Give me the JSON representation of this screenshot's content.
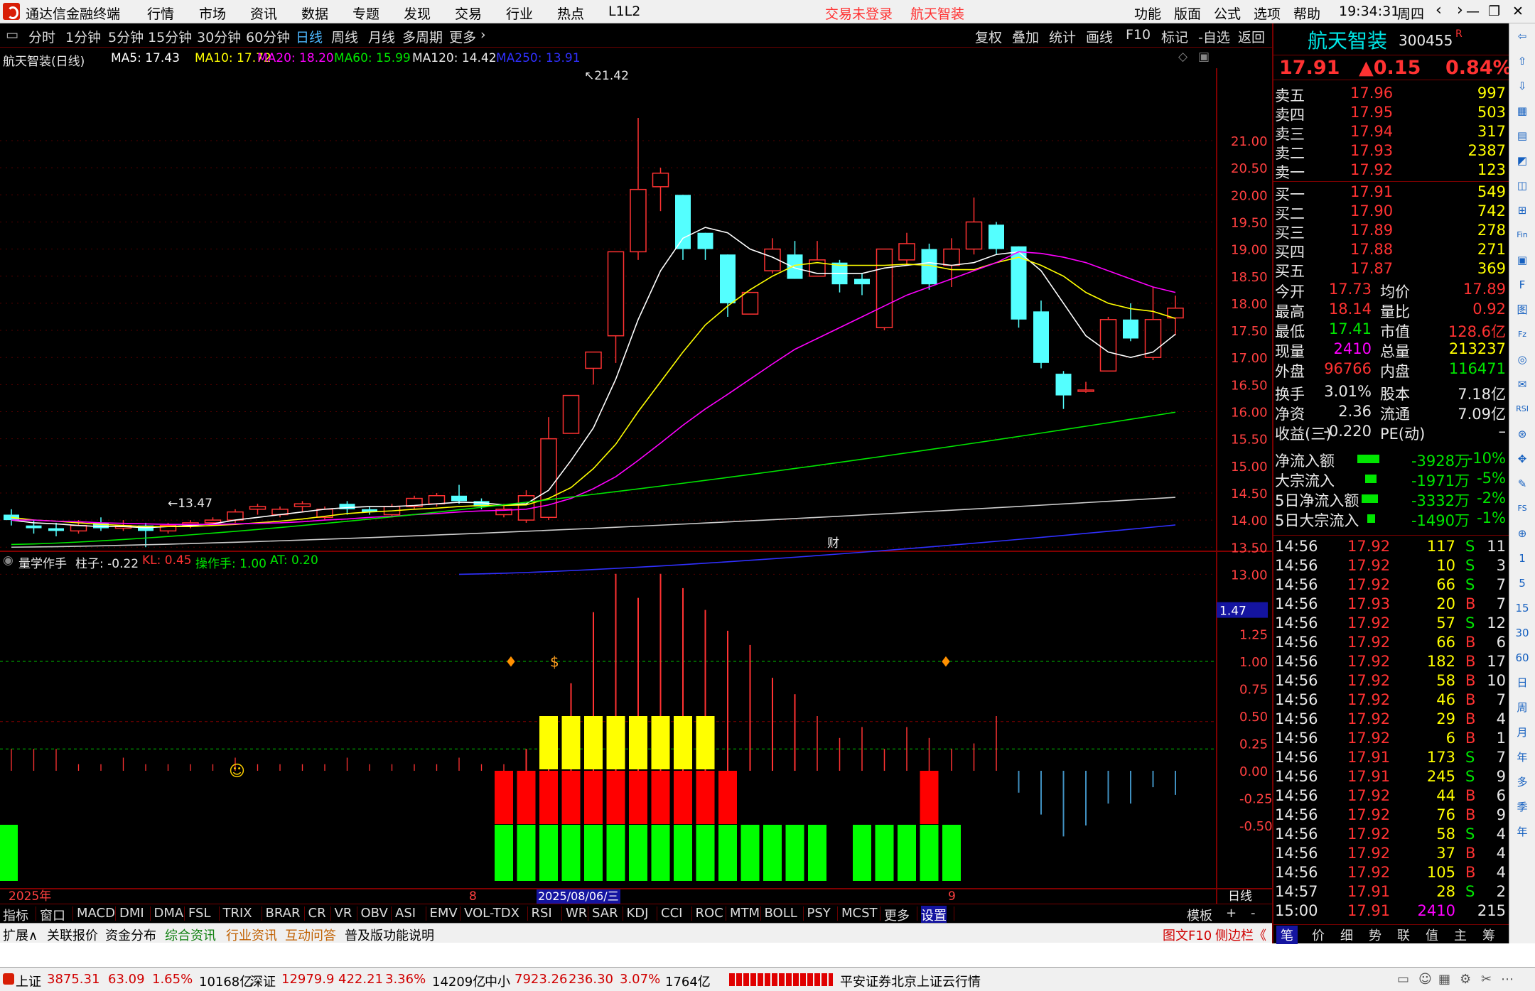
{
  "app": {
    "title": "通达信金融终端",
    "menus": [
      "行情",
      "市场",
      "资讯",
      "数据",
      "专题",
      "发现",
      "交易",
      "行业",
      "热点",
      "L1L2"
    ],
    "login": "交易未登录",
    "stock_link": "航天智装",
    "right_menus": [
      "功能",
      "版面",
      "公式",
      "选项",
      "帮助"
    ],
    "time": "19:34:31",
    "weekday": "周四"
  },
  "toolbar": {
    "periods": [
      "分时",
      "1分钟",
      "5分钟",
      "15分钟",
      "30分钟",
      "60分钟",
      "日线",
      "周线",
      "月线",
      "多周期",
      "更多"
    ],
    "active": "日线",
    "tools": [
      "复权",
      "叠加",
      "统计",
      "画线",
      "F10",
      "标记",
      "-自选",
      "返回"
    ]
  },
  "main_chart": {
    "name": "航天智装(日线)",
    "ma": [
      {
        "label": "MA5: 17.43",
        "color": "#ffffff"
      },
      {
        "label": "MA10: 17.72",
        "color": "#ffff00"
      },
      {
        "label": "MA20: 18.20",
        "color": "#ff00ff"
      },
      {
        "label": "MA60: 15.99",
        "color": "#00e600"
      },
      {
        "label": "MA120: 14.42",
        "color": "#e8e8e8"
      },
      {
        "label": "MA250: 13.91",
        "color": "#3030ff"
      }
    ],
    "high_label": "21.42",
    "low_label": "13.47",
    "marker": "财",
    "axis": [
      "21.00",
      "20.50",
      "20.00",
      "19.50",
      "19.00",
      "18.50",
      "18.00",
      "17.50",
      "17.00",
      "16.50",
      "16.00",
      "15.50",
      "15.00",
      "14.50",
      "14.00",
      "13.50",
      "13.00"
    ]
  },
  "chart_data": {
    "type": "candlestick",
    "candles": [
      [
        14.1,
        14.0,
        14.2,
        13.9
      ],
      [
        13.9,
        13.85,
        14.0,
        13.75
      ],
      [
        13.85,
        13.8,
        13.95,
        13.7
      ],
      [
        13.8,
        13.9,
        14.0,
        13.75
      ],
      [
        13.95,
        13.85,
        14.05,
        13.8
      ],
      [
        13.85,
        13.9,
        14.0,
        13.8
      ],
      [
        13.9,
        13.8,
        13.95,
        13.5
      ],
      [
        13.8,
        13.9,
        13.95,
        13.75
      ],
      [
        13.9,
        13.95,
        14.0,
        13.85
      ],
      [
        13.95,
        14.0,
        14.05,
        13.9
      ],
      [
        14.0,
        14.15,
        14.2,
        13.95
      ],
      [
        14.2,
        14.25,
        14.3,
        14.1
      ],
      [
        14.1,
        14.2,
        14.25,
        14.05
      ],
      [
        14.25,
        14.3,
        14.35,
        14.15
      ],
      [
        14.05,
        14.2,
        14.25,
        14.0
      ],
      [
        14.3,
        14.2,
        14.35,
        14.1
      ],
      [
        14.2,
        14.15,
        14.25,
        14.1
      ],
      [
        14.1,
        14.25,
        14.3,
        14.05
      ],
      [
        14.25,
        14.4,
        14.45,
        14.2
      ],
      [
        14.3,
        14.45,
        14.5,
        14.25
      ],
      [
        14.45,
        14.35,
        14.65,
        14.3
      ],
      [
        14.35,
        14.25,
        14.4,
        14.2
      ],
      [
        14.1,
        14.2,
        14.3,
        14.05
      ],
      [
        14.0,
        14.45,
        14.55,
        13.95
      ],
      [
        14.05,
        15.5,
        15.9,
        14.0
      ],
      [
        15.6,
        16.3,
        16.3,
        15.6
      ],
      [
        16.8,
        17.1,
        17.1,
        16.5
      ],
      [
        17.4,
        18.95,
        18.95,
        16.9
      ],
      [
        18.95,
        20.1,
        21.42,
        18.8
      ],
      [
        20.15,
        20.4,
        20.5,
        19.7
      ],
      [
        20.0,
        19.0,
        20.0,
        18.8
      ],
      [
        19.3,
        19.0,
        19.3,
        18.8
      ],
      [
        18.9,
        18.0,
        18.9,
        17.75
      ],
      [
        17.8,
        18.2,
        18.2,
        17.8
      ],
      [
        18.6,
        19.0,
        19.2,
        18.55
      ],
      [
        18.9,
        18.45,
        19.15,
        18.45
      ],
      [
        18.5,
        18.8,
        19.15,
        18.5
      ],
      [
        18.75,
        18.35,
        18.8,
        18.2
      ],
      [
        18.45,
        18.35,
        18.55,
        18.15
      ],
      [
        17.55,
        19.0,
        19.0,
        17.5
      ],
      [
        18.8,
        19.1,
        19.3,
        18.7
      ],
      [
        19.0,
        18.35,
        19.1,
        18.25
      ],
      [
        18.7,
        19.0,
        19.2,
        18.3
      ],
      [
        19.0,
        19.5,
        19.95,
        18.9
      ],
      [
        19.45,
        19.0,
        19.5,
        18.9
      ],
      [
        19.05,
        17.7,
        19.05,
        17.55
      ],
      [
        17.85,
        16.9,
        18.05,
        16.8
      ],
      [
        16.7,
        16.3,
        16.75,
        16.05
      ],
      [
        16.4,
        16.4,
        16.55,
        16.35
      ],
      [
        16.75,
        17.7,
        17.75,
        16.75
      ],
      [
        17.7,
        17.35,
        18.0,
        17.3
      ],
      [
        17.0,
        17.7,
        18.3,
        16.95
      ],
      [
        17.73,
        17.91,
        18.14,
        17.41
      ]
    ],
    "ma5": [
      14.0,
      13.95,
      13.93,
      13.9,
      13.88,
      13.88,
      13.86,
      13.88,
      13.9,
      13.93,
      14.0,
      14.05,
      14.1,
      14.15,
      14.2,
      14.23,
      14.25,
      14.25,
      14.27,
      14.3,
      14.33,
      14.32,
      14.28,
      14.3,
      14.55,
      15.1,
      15.7,
      16.6,
      17.7,
      18.6,
      19.2,
      19.4,
      19.3,
      19.0,
      18.85,
      18.65,
      18.55,
      18.55,
      18.55,
      18.65,
      18.7,
      18.75,
      18.7,
      18.75,
      18.9,
      18.95,
      18.6,
      18.0,
      17.4,
      17.1,
      17.0,
      17.1,
      17.43
    ],
    "ma10": [
      14.05,
      14.0,
      13.98,
      13.95,
      13.92,
      13.9,
      13.88,
      13.88,
      13.88,
      13.9,
      13.92,
      13.95,
      13.98,
      14.02,
      14.07,
      14.12,
      14.15,
      14.17,
      14.2,
      14.22,
      14.25,
      14.27,
      14.27,
      14.28,
      14.4,
      14.6,
      14.95,
      15.4,
      16.0,
      16.55,
      17.1,
      17.6,
      17.95,
      18.25,
      18.5,
      18.7,
      18.75,
      18.7,
      18.7,
      18.7,
      18.72,
      18.7,
      18.62,
      18.62,
      18.75,
      18.85,
      18.7,
      18.5,
      18.2,
      18.0,
      17.9,
      17.85,
      17.72
    ],
    "ma20": [
      14.0,
      14.0,
      13.98,
      13.97,
      13.95,
      13.94,
      13.93,
      13.92,
      13.92,
      13.92,
      13.93,
      13.94,
      13.95,
      13.97,
      14.0,
      14.02,
      14.05,
      14.07,
      14.1,
      14.12,
      14.15,
      14.17,
      14.18,
      14.2,
      14.28,
      14.4,
      14.58,
      14.8,
      15.1,
      15.42,
      15.75,
      16.05,
      16.32,
      16.6,
      16.88,
      17.15,
      17.35,
      17.55,
      17.75,
      17.95,
      18.15,
      18.3,
      18.45,
      18.6,
      18.75,
      18.95,
      18.92,
      18.85,
      18.75,
      18.6,
      18.45,
      18.3,
      18.2
    ],
    "ma60_range": [
      13.55,
      15.99
    ],
    "ma120_range": [
      13.5,
      14.42
    ],
    "ma250_range": [
      13.0,
      13.91
    ]
  },
  "indicator": {
    "name": "量学作手",
    "zhu": "柱子: -0.22",
    "kl": "KL: 0.45",
    "czs": "操作手: 1.00",
    "at": "AT: 0.20",
    "value_label": "1.47",
    "axis": [
      "1.25",
      "1.00",
      "0.75",
      "0.50",
      "0.25",
      "0.00",
      "-0.25",
      "-0.50"
    ]
  },
  "xaxis": {
    "year": "2025年",
    "mark1": "8",
    "date": "2025/08/06/三",
    "mark2": "9",
    "period": "日线"
  },
  "bottom_tabs": [
    "指标",
    "窗口",
    "MACD",
    "DMI",
    "DMA",
    "FSL",
    "TRIX",
    "BRAR",
    "CR",
    "VR",
    "OBV",
    "ASI",
    "EMV",
    "VOL-TDX",
    "RSI",
    "WR",
    "SAR",
    "KDJ",
    "CCI",
    "ROC",
    "MTM",
    "BOLL",
    "PSY",
    "MCST",
    "更多",
    "设置"
  ],
  "bottom_right": [
    "模板",
    "+",
    "-"
  ],
  "ext_tabs": [
    "扩展∧",
    "关联报价",
    "资金分布",
    "综合资讯",
    "行业资讯",
    "互动问答",
    "普及版功能说明"
  ],
  "ext_right": [
    "图文F10",
    "侧边栏《"
  ],
  "quote": {
    "name": "航天智装",
    "code": "300455",
    "r": "R",
    "price": "17.91",
    "change": "▲0.15",
    "pct": "0.84%",
    "asks": [
      {
        "label": "卖五",
        "price": "17.96",
        "vol": "997"
      },
      {
        "label": "卖四",
        "price": "17.95",
        "vol": "503"
      },
      {
        "label": "卖三",
        "price": "17.94",
        "vol": "317"
      },
      {
        "label": "卖二",
        "price": "17.93",
        "vol": "2387"
      },
      {
        "label": "卖一",
        "price": "17.92",
        "vol": "123"
      }
    ],
    "bids": [
      {
        "label": "买一",
        "price": "17.91",
        "vol": "549"
      },
      {
        "label": "买二",
        "price": "17.90",
        "vol": "742"
      },
      {
        "label": "买三",
        "price": "17.89",
        "vol": "278"
      },
      {
        "label": "买四",
        "price": "17.88",
        "vol": "271"
      },
      {
        "label": "买五",
        "price": "17.87",
        "vol": "369"
      }
    ],
    "stats": [
      [
        "今开",
        "17.73",
        "均价",
        "17.89"
      ],
      [
        "最高",
        "18.14",
        "量比",
        "0.92"
      ],
      [
        "最低",
        "17.41",
        "市值",
        "128.6亿"
      ],
      [
        "现量",
        "2410",
        "总量",
        "213237"
      ],
      [
        "外盘",
        "96766",
        "内盘",
        "116471"
      ]
    ],
    "stats2": [
      [
        "换手",
        "3.01%",
        "股本",
        "7.18亿"
      ],
      [
        "净资",
        "2.36",
        "流通",
        "7.09亿"
      ],
      [
        "收益(三)",
        "-0.220",
        "PE(动)",
        "–"
      ]
    ],
    "flows": [
      {
        "label": "净流入额",
        "val": "-3928万",
        "pct": "-10%",
        "bar": 0.7
      },
      {
        "label": "大宗流入",
        "val": "-1971万",
        "pct": "-5%",
        "bar": 0.35
      },
      {
        "label": "5日净流入额",
        "val": "-3332万",
        "pct": "-2%",
        "bar": 0.5
      },
      {
        "label": "5日大宗流入",
        "val": "-1490万",
        "pct": "-1%",
        "bar": 0.25
      }
    ],
    "ticks": [
      [
        "14:56",
        "17.92",
        "117",
        "S",
        "11"
      ],
      [
        "14:56",
        "17.92",
        "10",
        "S",
        "3"
      ],
      [
        "14:56",
        "17.92",
        "66",
        "S",
        "7"
      ],
      [
        "14:56",
        "17.93",
        "20",
        "B",
        "7"
      ],
      [
        "14:56",
        "17.92",
        "57",
        "S",
        "12"
      ],
      [
        "14:56",
        "17.92",
        "66",
        "B",
        "6"
      ],
      [
        "14:56",
        "17.92",
        "182",
        "B",
        "17"
      ],
      [
        "14:56",
        "17.92",
        "58",
        "B",
        "10"
      ],
      [
        "14:56",
        "17.92",
        "46",
        "B",
        "7"
      ],
      [
        "14:56",
        "17.92",
        "29",
        "B",
        "4"
      ],
      [
        "14:56",
        "17.92",
        "6",
        "B",
        "1"
      ],
      [
        "14:56",
        "17.91",
        "173",
        "S",
        "7"
      ],
      [
        "14:56",
        "17.91",
        "245",
        "S",
        "9"
      ],
      [
        "14:56",
        "17.92",
        "44",
        "B",
        "6"
      ],
      [
        "14:56",
        "17.92",
        "76",
        "B",
        "9"
      ],
      [
        "14:56",
        "17.92",
        "58",
        "S",
        "4"
      ],
      [
        "14:56",
        "17.92",
        "37",
        "B",
        "4"
      ],
      [
        "14:56",
        "17.92",
        "105",
        "B",
        "4"
      ],
      [
        "14:57",
        "17.91",
        "28",
        "S",
        "2"
      ],
      [
        "15:00",
        "17.91",
        "2410",
        "",
        "215"
      ]
    ],
    "tabs": [
      "笔",
      "价",
      "细",
      "势",
      "联",
      "值",
      "主",
      "筹"
    ]
  },
  "sidebar": [
    "⇦",
    "⇧",
    "⇩",
    "▦",
    "▤",
    "◩",
    "◫",
    "⊞",
    "Fin",
    "▣",
    "F",
    "图",
    "Fz",
    "◎",
    "✉",
    "RSI",
    "⊛",
    "✥",
    "✎",
    "FS",
    "⊕",
    "1",
    "5",
    "15",
    "30",
    "60",
    "日",
    "周",
    "月",
    "年",
    "多",
    "季",
    "年"
  ],
  "status": {
    "sh_label": "上证",
    "sh": "3875.31",
    "sh_ch": "63.09",
    "sh_pct": "1.65%",
    "sh_amt": "10168亿",
    "sz_label": "深证",
    "sz": "12979.9",
    "sz_ch": "422.21",
    "sz_pct": "3.36%",
    "sz_amt": "14209亿",
    "zx_label": "中小",
    "zx": "7923.26",
    "zx_ch": "236.30",
    "zx_pct": "3.07%",
    "zx_amt": "1764亿",
    "broker": "平安证券北京上证云行情"
  }
}
